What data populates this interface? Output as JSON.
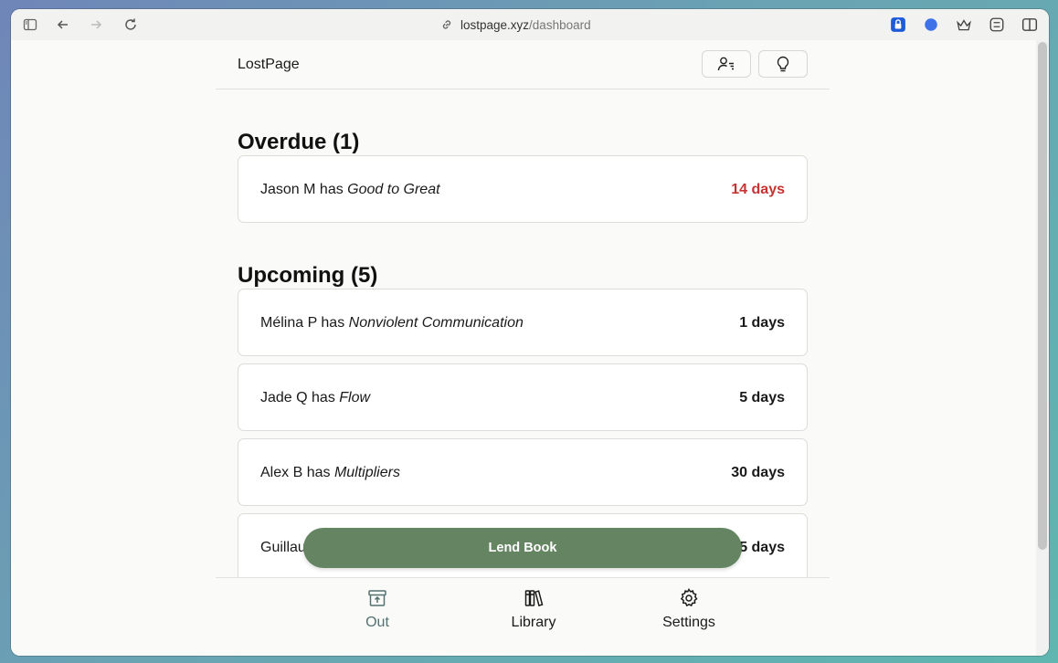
{
  "browser": {
    "url_domain": "lostpage.xyz",
    "url_path": "/dashboard"
  },
  "app": {
    "brand": "LostPage"
  },
  "overdue": {
    "title": "Overdue (1)",
    "items": [
      {
        "person": "Jason M has ",
        "book": "Good to Great",
        "days": "14 days"
      }
    ]
  },
  "upcoming": {
    "title": "Upcoming (5)",
    "items": [
      {
        "person": "Mélina P has ",
        "book": "Nonviolent Communication",
        "days": "1 days"
      },
      {
        "person": "Jade Q has ",
        "book": "Flow",
        "days": "5 days"
      },
      {
        "person": "Alex B has ",
        "book": "Multipliers",
        "days": "30 days"
      },
      {
        "person": "Guillau",
        "book": "",
        "days": "5 days"
      }
    ]
  },
  "actions": {
    "lend_label": "Lend Book"
  },
  "nav": {
    "out": "Out",
    "library": "Library",
    "settings": "Settings"
  },
  "colors": {
    "accent": "#658562",
    "overdue": "#c83232",
    "active_nav": "#53716f"
  }
}
